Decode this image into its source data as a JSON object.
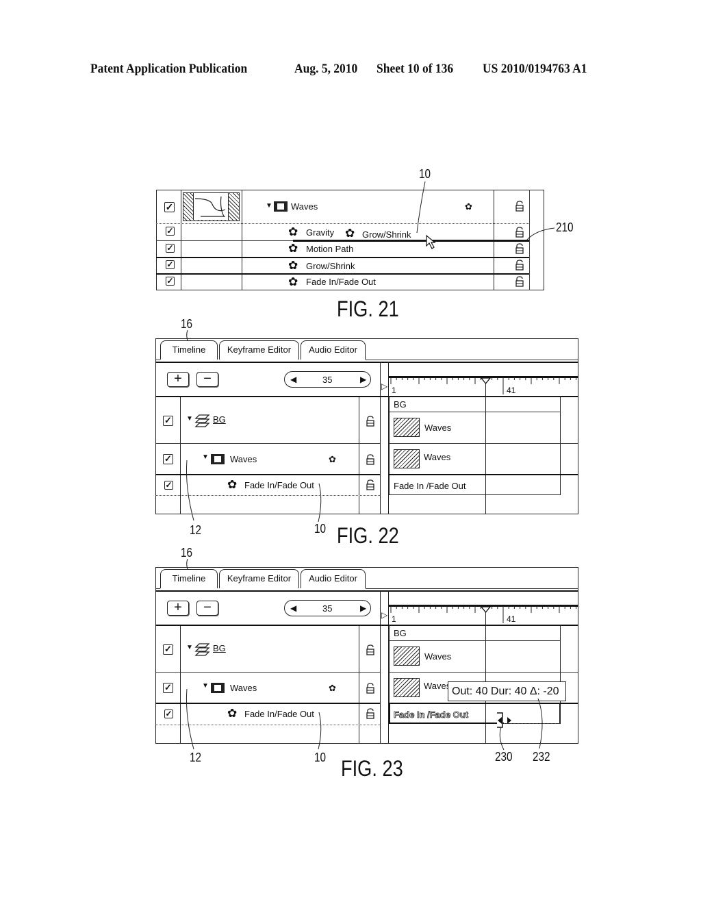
{
  "header": {
    "publication": "Patent Application Publication",
    "date": "Aug. 5, 2010",
    "sheet": "Sheet 10 of 136",
    "number": "US 2010/0194763 A1"
  },
  "fig21": {
    "label": "FIG. 21",
    "ref_10": "10",
    "ref_210": "210",
    "rows": [
      {
        "label": "Waves",
        "checked": true,
        "has_thumbnail": true,
        "has_expand": true,
        "has_clip_icon": true,
        "has_behavior_icon": true
      },
      {
        "label": "Gravity",
        "checked": true,
        "drag_label": "Grow/Shrink"
      },
      {
        "label": "Motion Path",
        "checked": true
      },
      {
        "label": "Grow/Shrink",
        "checked": true,
        "highlighted": true
      },
      {
        "label": "Fade In/Fade Out",
        "checked": true
      }
    ]
  },
  "fig22": {
    "label": "FIG. 22",
    "ref_16": "16",
    "ref_12": "12",
    "ref_10": "10",
    "tabs": [
      "Timeline",
      "Keyframe Editor",
      "Audio Editor"
    ],
    "active_tab": "Timeline",
    "add_label": "+",
    "remove_label": "−",
    "stepper_value": "35",
    "ruler": {
      "start": "1",
      "mark": "41",
      "playhead": 35
    },
    "layers": [
      {
        "label": "BG",
        "type": "group"
      },
      {
        "label": "Waves",
        "type": "clip"
      },
      {
        "label": "Fade In/Fade Out",
        "type": "behavior"
      }
    ],
    "tracks": [
      "BG",
      "Waves",
      "Waves",
      "Fade In /Fade Out"
    ]
  },
  "fig23": {
    "label": "FIG. 23",
    "ref_16": "16",
    "ref_12": "12",
    "ref_10": "10",
    "ref_230": "230",
    "ref_232": "232",
    "tabs": [
      "Timeline",
      "Keyframe Editor",
      "Audio Editor"
    ],
    "active_tab": "Timeline",
    "add_label": "+",
    "remove_label": "−",
    "stepper_value": "35",
    "ruler": {
      "start": "1",
      "mark": "41",
      "playhead": 35
    },
    "layers": [
      {
        "label": "BG",
        "type": "group"
      },
      {
        "label": "Waves",
        "type": "clip"
      },
      {
        "label": "Fade In/Fade Out",
        "type": "behavior"
      }
    ],
    "tracks": [
      "BG",
      "Waves",
      "Waves",
      "Fade In /Fade Out"
    ],
    "tooltip": "Out: 40 Dur: 40 Δ: -20"
  },
  "icons": {
    "check": "✓",
    "gear": "✿",
    "expand": "▼",
    "left": "◀",
    "right": "▶"
  }
}
